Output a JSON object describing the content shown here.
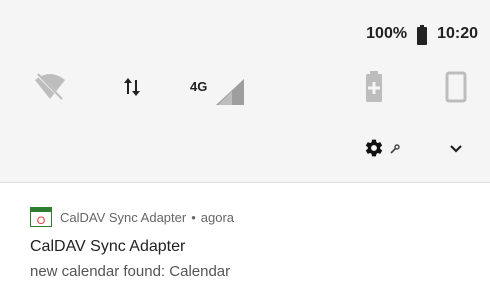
{
  "status_bar": {
    "battery_text": "100%",
    "time": "10:20"
  },
  "quick_settings": {
    "tiles": [
      {
        "icon": "wifi-off-icon"
      },
      {
        "icon": "data-transfer-icon"
      },
      {
        "icon": "signal-4g-icon",
        "label": "4G"
      },
      {
        "icon": "battery-saver-icon"
      },
      {
        "icon": "auto-rotate-icon"
      }
    ]
  },
  "controls": {
    "settings_icon": "gear-icon",
    "expand_icon": "chevron-down-icon"
  },
  "notification": {
    "app_name": "CalDAV Sync Adapter",
    "separator": "•",
    "time": "agora",
    "title": "CalDAV Sync Adapter",
    "text": "new calendar found: Calendar",
    "icon_color": "#2e7d32",
    "icon_accent": "#e53935"
  }
}
